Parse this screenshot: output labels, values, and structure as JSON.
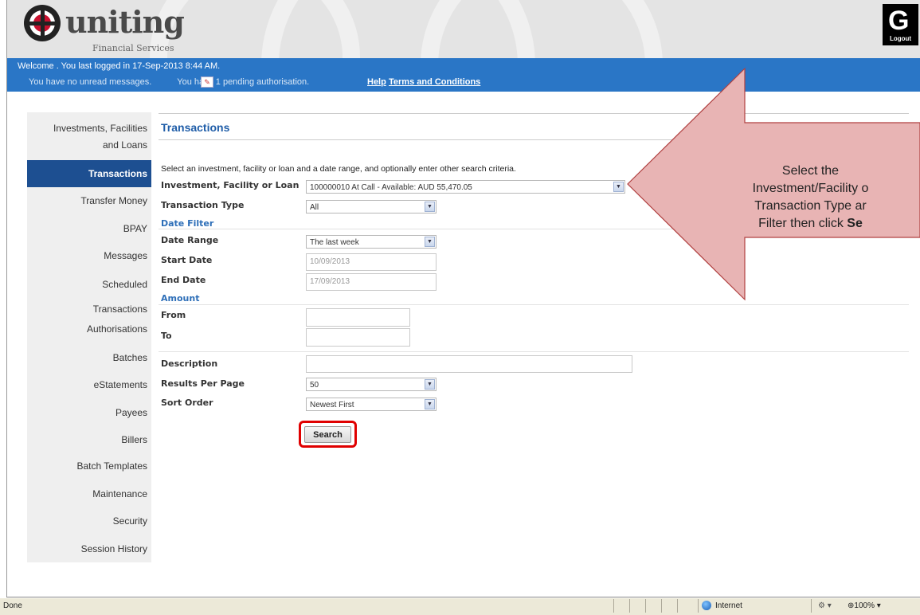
{
  "header": {
    "brand": "uniting",
    "brand_sub": "Financial Services",
    "logout_label": "Logout"
  },
  "bluebar": {
    "welcome": "Welcome . You last logged in 17-Sep-2013 8:44 AM.",
    "messages": "You have no unread messages.",
    "pending": "You have 1 pending authorisation.",
    "help": "Help",
    "terms": "Terms and Conditions"
  },
  "nav": {
    "items": [
      {
        "label": "Investments, Facilities",
        "label2": "and Loans"
      },
      {
        "label": "Transactions",
        "active": true
      },
      {
        "label": "Transfer Money"
      },
      {
        "label": "BPAY"
      },
      {
        "label": "Messages"
      },
      {
        "label": "Scheduled",
        "label2": "Transactions"
      },
      {
        "label": "Authorisations"
      },
      {
        "label": "Batches"
      },
      {
        "label": "eStatements"
      },
      {
        "label": "Payees"
      },
      {
        "label": "Billers"
      },
      {
        "label": "Batch Templates"
      },
      {
        "label": "Maintenance"
      },
      {
        "label": "Security"
      },
      {
        "label": "Session History"
      }
    ]
  },
  "main": {
    "title": "Transactions",
    "instructions": "Select an investment, facility or loan and a date range, and optionally enter other search criteria.",
    "labels": {
      "investment": "Investment, Facility or Loan",
      "transaction_type": "Transaction Type",
      "date_filter": "Date Filter",
      "date_range": "Date Range",
      "start_date": "Start Date",
      "end_date": "End Date",
      "amount": "Amount",
      "from": "From",
      "to": "To",
      "description": "Description",
      "results_per_page": "Results Per Page",
      "sort_order": "Sort Order"
    },
    "values": {
      "investment": "100000010 At Call - Available: AUD 55,470.05",
      "transaction_type": "All",
      "date_range": "The last week",
      "start_date": "10/09/2013",
      "end_date": "17/09/2013",
      "from": "",
      "to": "",
      "description": "",
      "results_per_page": "50",
      "sort_order": "Newest First"
    },
    "search_button": "Search"
  },
  "callout": {
    "line1": "Select the",
    "line2": "Investment/Facility o",
    "line3": "Transaction Type ar",
    "line4_pre": "Filter then click ",
    "line4_bold": "Se"
  },
  "statusbar": {
    "left": "Done",
    "zone": "Internet",
    "zoom": "100%"
  },
  "colors": {
    "header_blue": "#2a76c6",
    "nav_active": "#1d4f91",
    "title_blue": "#1f5da8",
    "callout_fill": "#e8b4b4",
    "callout_stroke": "#b04040",
    "highlight_red": "#e00000"
  }
}
